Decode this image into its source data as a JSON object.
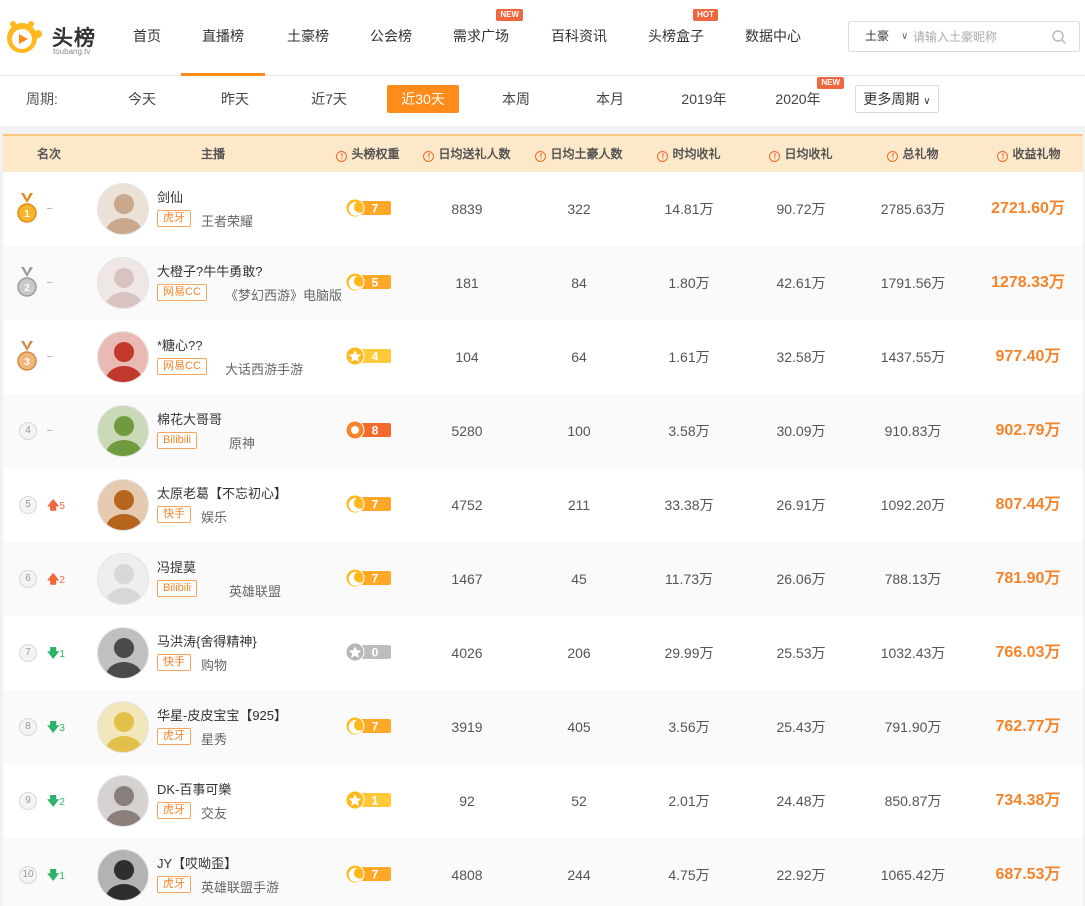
{
  "brand": {
    "name": "头榜",
    "sub": "toubang.tv"
  },
  "nav": [
    {
      "label": "首页",
      "active": false,
      "badge": ""
    },
    {
      "label": "直播榜",
      "active": true,
      "badge": ""
    },
    {
      "label": "土豪榜",
      "active": false,
      "badge": ""
    },
    {
      "label": "公会榜",
      "active": false,
      "badge": ""
    },
    {
      "label": "需求广场",
      "active": false,
      "badge": "NEW"
    },
    {
      "label": "百科资讯",
      "active": false,
      "badge": ""
    },
    {
      "label": "头榜盒子",
      "active": false,
      "badge": "HOT"
    },
    {
      "label": "数据中心",
      "active": false,
      "badge": ""
    }
  ],
  "search": {
    "type": "土豪",
    "placeholder": "请输入土豪昵称"
  },
  "period": {
    "label": "周期:",
    "options": [
      {
        "label": "今天",
        "active": false,
        "badge": ""
      },
      {
        "label": "昨天",
        "active": false,
        "badge": ""
      },
      {
        "label": "近7天",
        "active": false,
        "badge": ""
      },
      {
        "label": "近30天",
        "active": true,
        "badge": ""
      },
      {
        "label": "本周",
        "active": false,
        "badge": ""
      },
      {
        "label": "本月",
        "active": false,
        "badge": ""
      },
      {
        "label": "2019年",
        "active": false,
        "badge": ""
      },
      {
        "label": "2020年",
        "active": false,
        "badge": "NEW"
      }
    ],
    "more": "更多周期"
  },
  "table": {
    "headers": {
      "rank": "名次",
      "anchor": "主播",
      "weight": "头榜权重",
      "senders": "日均送礼人数",
      "tycoons": "日均土豪人数",
      "hourly": "时均收礼",
      "daily": "日均收礼",
      "total": "总礼物",
      "income": "收益礼物"
    },
    "rows": [
      {
        "rank": "1",
        "medal": "gold",
        "trend": "same",
        "trend_text": "–",
        "name": "剑仙",
        "platform": "虎牙",
        "category": "王者荣耀",
        "weight": "7",
        "weight_icon": "moon",
        "senders": "8839",
        "tycoons": "322",
        "hourly": "14.81万",
        "daily": "90.72万",
        "total": "2785.63万",
        "income": "2721.60万",
        "avatar": "#c9a88c"
      },
      {
        "rank": "2",
        "medal": "silver",
        "trend": "same",
        "trend_text": "–",
        "name": "大橙子?牛牛勇敢?",
        "platform": "网易CC",
        "category": "《梦幻西游》电脑版",
        "weight": "5",
        "weight_icon": "moon",
        "senders": "181",
        "tycoons": "84",
        "hourly": "1.80万",
        "daily": "42.61万",
        "total": "1791.56万",
        "income": "1278.33万",
        "avatar": "#d9c3c0"
      },
      {
        "rank": "3",
        "medal": "bronze",
        "trend": "same",
        "trend_text": "–",
        "name": "*糖心??",
        "platform": "网易CC",
        "category": "大话西游手游",
        "weight": "4",
        "weight_icon": "star",
        "senders": "104",
        "tycoons": "64",
        "hourly": "1.61万",
        "daily": "32.58万",
        "total": "1437.55万",
        "income": "977.40万",
        "avatar": "#c0392b"
      },
      {
        "rank": "4",
        "medal": "",
        "trend": "same",
        "trend_text": "–",
        "name": "棉花大哥哥",
        "platform": "Bilibili",
        "category": "原神",
        "weight": "8",
        "weight_icon": "sun",
        "senders": "5280",
        "tycoons": "100",
        "hourly": "3.58万",
        "daily": "30.09万",
        "total": "910.83万",
        "income": "902.79万",
        "avatar": "#6f9a3d"
      },
      {
        "rank": "5",
        "medal": "",
        "trend": "up",
        "trend_text": "5",
        "name": "太原老葛【不忘初心】",
        "platform": "快手",
        "category": "娱乐",
        "weight": "7",
        "weight_icon": "moon",
        "senders": "4752",
        "tycoons": "211",
        "hourly": "33.38万",
        "daily": "26.91万",
        "total": "1092.20万",
        "income": "807.44万",
        "avatar": "#b5651d"
      },
      {
        "rank": "6",
        "medal": "",
        "trend": "up",
        "trend_text": "2",
        "name": "冯提莫",
        "platform": "Bilibili",
        "category": "英雄联盟",
        "weight": "7",
        "weight_icon": "moon",
        "senders": "1467",
        "tycoons": "45",
        "hourly": "11.73万",
        "daily": "26.06万",
        "total": "788.13万",
        "income": "781.90万",
        "avatar": "#d8d8d8"
      },
      {
        "rank": "7",
        "medal": "",
        "trend": "down",
        "trend_text": "1",
        "name": "马洪涛{舍得精神}",
        "platform": "快手",
        "category": "购物",
        "weight": "0",
        "weight_icon": "grey",
        "senders": "4026",
        "tycoons": "206",
        "hourly": "29.99万",
        "daily": "25.53万",
        "total": "1032.43万",
        "income": "766.03万",
        "avatar": "#4a4a4a"
      },
      {
        "rank": "8",
        "medal": "",
        "trend": "down",
        "trend_text": "3",
        "name": "华星-皮皮宝宝【925】",
        "platform": "虎牙",
        "category": "星秀",
        "weight": "7",
        "weight_icon": "moon",
        "senders": "3919",
        "tycoons": "405",
        "hourly": "3.56万",
        "daily": "25.43万",
        "total": "791.90万",
        "income": "762.77万",
        "avatar": "#e3c04a"
      },
      {
        "rank": "9",
        "medal": "",
        "trend": "down",
        "trend_text": "2",
        "name": "DK-百事可樂",
        "platform": "虎牙",
        "category": "交友",
        "weight": "1",
        "weight_icon": "star",
        "senders": "92",
        "tycoons": "52",
        "hourly": "2.01万",
        "daily": "24.48万",
        "total": "850.87万",
        "income": "734.38万",
        "avatar": "#8a7f7a"
      },
      {
        "rank": "10",
        "medal": "",
        "trend": "down",
        "trend_text": "1",
        "name": "JY【哎呦歪】",
        "platform": "虎牙",
        "category": "英雄联盟手游",
        "weight": "7",
        "weight_icon": "moon",
        "senders": "4808",
        "tycoons": "244",
        "hourly": "4.75万",
        "daily": "22.92万",
        "total": "1065.42万",
        "income": "687.53万",
        "avatar": "#2e2e2e"
      }
    ]
  },
  "colors": {
    "accent": "#ff8b1a",
    "income": "#f5832a",
    "up": "#f0663f",
    "down": "#2cb368",
    "header_bg": "#fde9c9"
  }
}
